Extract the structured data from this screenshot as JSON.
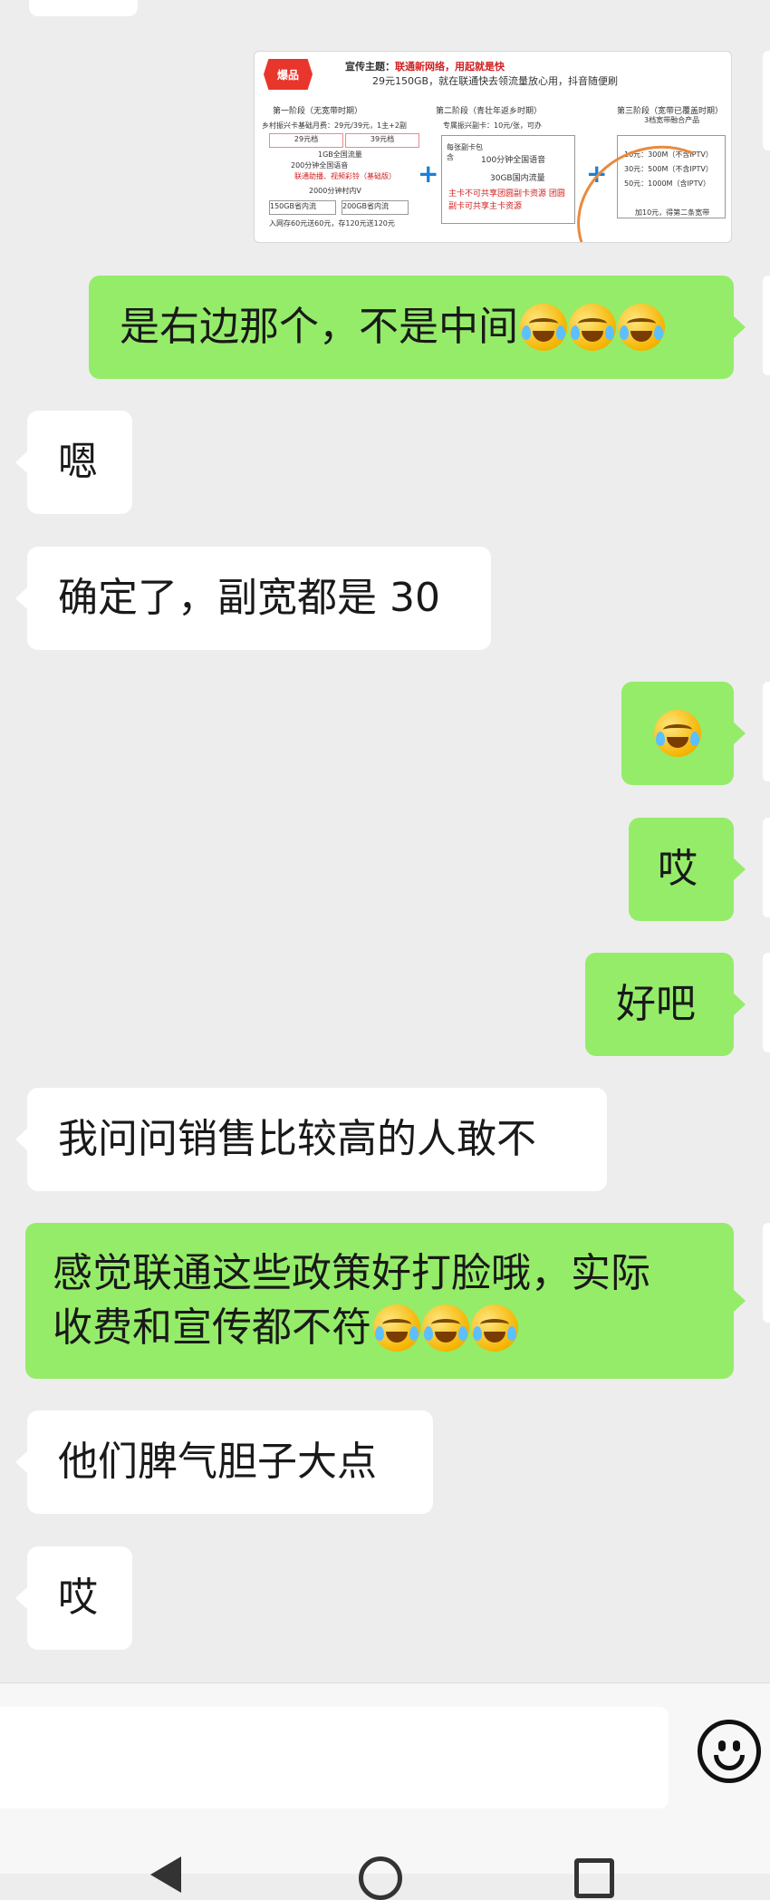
{
  "image_card": {
    "badge": "爆品",
    "theme_label": "宣传主题：",
    "theme_text": "联通新网络，用起就是快",
    "line1": "29元150GB，就在联通快去领流量放心用，抖音随便刷",
    "stage1": "第一阶段（无宽带时期）",
    "stage2": "第二阶段（青壮年返乡时期）",
    "stage3": "第三阶段（宽带已覆盖时期）",
    "rural": "乡村振兴卡基础月费：29元/39元，1主+2副",
    "fee29": "29元档",
    "fee39": "39元档",
    "flow1": "1GB全国流量",
    "voice200": "200分钟全国语音",
    "perk": "联通助播、视频彩铃（基础版）",
    "village": "2000分钟村内V",
    "g150": "150GB省内流",
    "g200": "200GB省内流",
    "deposit": "入网存60元送60元，存120元送120元",
    "sub_card": "专属振兴副卡：10元/张，可办",
    "sub_label": "每张副卡包含",
    "sub_voice": "100分钟全国语音",
    "sub_data": "30GB国内流量",
    "sub_note": "主卡不可共享团圆副卡资源  团圆副卡可共享主卡资源",
    "bb_title": "3档宽带融合产品",
    "bb1": "10元：300M（不含IPTV）",
    "bb2": "30元：500M（不含IPTV）",
    "bb3": "50元：1000M（含IPTV）",
    "bb_note": "加10元，得第二条宽带"
  },
  "messages": [
    {
      "side": "out",
      "text": "是右边那个，不是中间",
      "emoji_count": 3
    },
    {
      "side": "in",
      "text": "嗯",
      "emoji_count": 0
    },
    {
      "side": "in",
      "text": "确定了，副宽都是 30",
      "emoji_count": 0
    },
    {
      "side": "out",
      "text": "",
      "emoji_count": 1
    },
    {
      "side": "out",
      "text": "哎",
      "emoji_count": 0
    },
    {
      "side": "out",
      "text": "好吧",
      "emoji_count": 0
    },
    {
      "side": "in",
      "text": "我问问销售比较高的人敢不",
      "emoji_count": 0
    },
    {
      "side": "out",
      "text_line1": "感觉联通这些政策好打脸哦，实际",
      "text_line2": "收费和宣传都不符",
      "emoji_count": 3
    },
    {
      "side": "in",
      "text": "他们脾气胆子大点",
      "emoji_count": 0
    },
    {
      "side": "in",
      "text": "哎",
      "emoji_count": 0
    }
  ],
  "emoji_name": "loudly-crying-face-icon",
  "colors": {
    "background": "#ededed",
    "outgoing": "#95ec69",
    "incoming": "#ffffff"
  }
}
